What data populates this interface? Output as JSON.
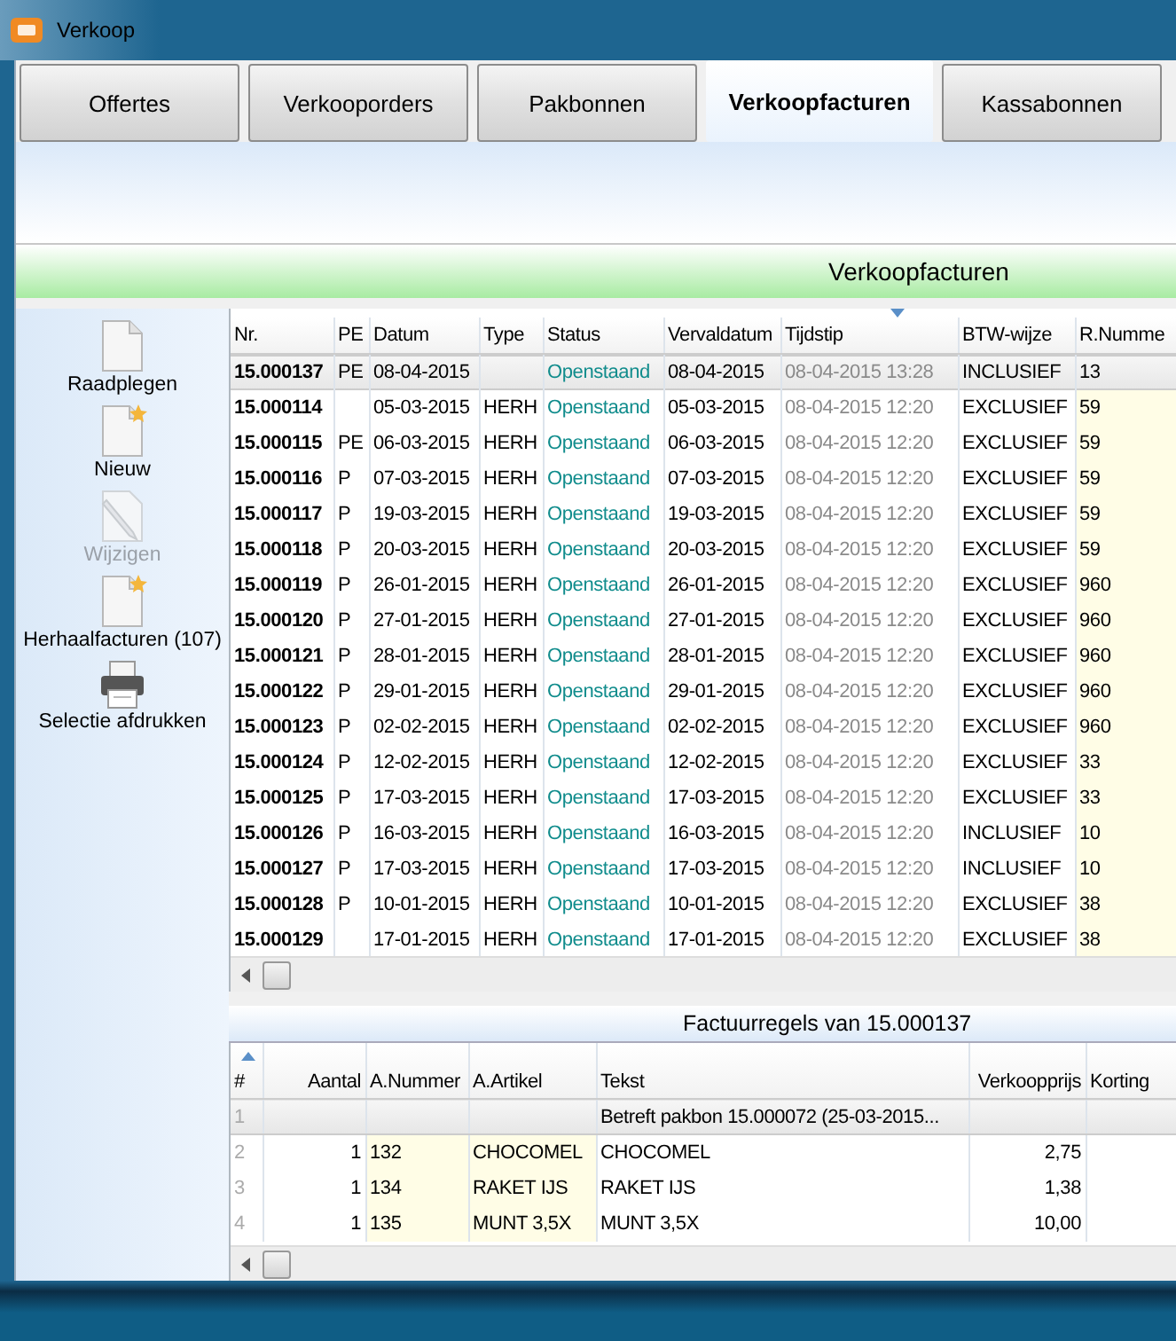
{
  "window": {
    "title": "Verkoop"
  },
  "tabs": [
    {
      "label": "Offertes",
      "selected": false
    },
    {
      "label": "Verkooporders",
      "selected": false
    },
    {
      "label": "Pakbonnen",
      "selected": false
    },
    {
      "label": "Verkoopfacturen",
      "selected": true
    },
    {
      "label": "Kassabonnen",
      "selected": false
    }
  ],
  "section_title": "Verkoopfacturen",
  "sidebar": {
    "items": [
      {
        "label": "Raadplegen",
        "kind": "document",
        "disabled": false
      },
      {
        "label": "Nieuw",
        "kind": "new-document",
        "disabled": false
      },
      {
        "label": "Wijzigen",
        "kind": "edit",
        "disabled": true
      },
      {
        "label": "Herhaalfacturen (107)",
        "kind": "new-document",
        "disabled": false
      },
      {
        "label": "Selectie afdrukken",
        "kind": "printer",
        "disabled": false
      }
    ]
  },
  "invoices": {
    "columns": [
      "Nr.",
      "PE",
      "Datum",
      "Type",
      "Status",
      "Vervaldatum",
      "Tijdstip",
      "BTW-wijze",
      "R.Numme"
    ],
    "rows": [
      {
        "selected": true,
        "cells": [
          "15.000137",
          "PE",
          "08-04-2015",
          "",
          "Openstaand",
          "08-04-2015",
          "08-04-2015 13:28",
          "INCLUSIEF",
          "13"
        ]
      },
      {
        "selected": false,
        "cells": [
          "15.000114",
          "",
          "05-03-2015",
          "HERH",
          "Openstaand",
          "05-03-2015",
          "08-04-2015 12:20",
          "EXCLUSIEF",
          "59"
        ]
      },
      {
        "selected": false,
        "cells": [
          "15.000115",
          "PE",
          "06-03-2015",
          "HERH",
          "Openstaand",
          "06-03-2015",
          "08-04-2015 12:20",
          "EXCLUSIEF",
          "59"
        ]
      },
      {
        "selected": false,
        "cells": [
          "15.000116",
          "P",
          "07-03-2015",
          "HERH",
          "Openstaand",
          "07-03-2015",
          "08-04-2015 12:20",
          "EXCLUSIEF",
          "59"
        ]
      },
      {
        "selected": false,
        "cells": [
          "15.000117",
          "P",
          "19-03-2015",
          "HERH",
          "Openstaand",
          "19-03-2015",
          "08-04-2015 12:20",
          "EXCLUSIEF",
          "59"
        ]
      },
      {
        "selected": false,
        "cells": [
          "15.000118",
          "P",
          "20-03-2015",
          "HERH",
          "Openstaand",
          "20-03-2015",
          "08-04-2015 12:20",
          "EXCLUSIEF",
          "59"
        ]
      },
      {
        "selected": false,
        "cells": [
          "15.000119",
          "P",
          "26-01-2015",
          "HERH",
          "Openstaand",
          "26-01-2015",
          "08-04-2015 12:20",
          "EXCLUSIEF",
          "960"
        ]
      },
      {
        "selected": false,
        "cells": [
          "15.000120",
          "P",
          "27-01-2015",
          "HERH",
          "Openstaand",
          "27-01-2015",
          "08-04-2015 12:20",
          "EXCLUSIEF",
          "960"
        ]
      },
      {
        "selected": false,
        "cells": [
          "15.000121",
          "P",
          "28-01-2015",
          "HERH",
          "Openstaand",
          "28-01-2015",
          "08-04-2015 12:20",
          "EXCLUSIEF",
          "960"
        ]
      },
      {
        "selected": false,
        "cells": [
          "15.000122",
          "P",
          "29-01-2015",
          "HERH",
          "Openstaand",
          "29-01-2015",
          "08-04-2015 12:20",
          "EXCLUSIEF",
          "960"
        ]
      },
      {
        "selected": false,
        "cells": [
          "15.000123",
          "P",
          "02-02-2015",
          "HERH",
          "Openstaand",
          "02-02-2015",
          "08-04-2015 12:20",
          "EXCLUSIEF",
          "960"
        ]
      },
      {
        "selected": false,
        "cells": [
          "15.000124",
          "P",
          "12-02-2015",
          "HERH",
          "Openstaand",
          "12-02-2015",
          "08-04-2015 12:20",
          "EXCLUSIEF",
          "33"
        ]
      },
      {
        "selected": false,
        "cells": [
          "15.000125",
          "P",
          "17-03-2015",
          "HERH",
          "Openstaand",
          "17-03-2015",
          "08-04-2015 12:20",
          "EXCLUSIEF",
          "33"
        ]
      },
      {
        "selected": false,
        "cells": [
          "15.000126",
          "P",
          "16-03-2015",
          "HERH",
          "Openstaand",
          "16-03-2015",
          "08-04-2015 12:20",
          "INCLUSIEF",
          "10"
        ]
      },
      {
        "selected": false,
        "cells": [
          "15.000127",
          "P",
          "17-03-2015",
          "HERH",
          "Openstaand",
          "17-03-2015",
          "08-04-2015 12:20",
          "INCLUSIEF",
          "10"
        ]
      },
      {
        "selected": false,
        "cells": [
          "15.000128",
          "P",
          "10-01-2015",
          "HERH",
          "Openstaand",
          "10-01-2015",
          "08-04-2015 12:20",
          "EXCLUSIEF",
          "38"
        ]
      },
      {
        "selected": false,
        "cells": [
          "15.000129",
          "",
          "17-01-2015",
          "HERH",
          "Openstaand",
          "17-01-2015",
          "08-04-2015 12:20",
          "EXCLUSIEF",
          "38"
        ]
      }
    ]
  },
  "lines": {
    "title": "Factuurregels van 15.000137",
    "columns": [
      "#",
      "Aantal",
      "A.Nummer",
      "A.Artikel",
      "Tekst",
      "Verkoopprijs",
      "Korting"
    ],
    "rows": [
      {
        "kind": "note",
        "cells": [
          "1",
          "",
          "",
          "",
          "Betreft pakbon 15.000072 (25-03-2015...",
          "",
          ""
        ]
      },
      {
        "kind": "item",
        "cells": [
          "2",
          "1",
          "132",
          "CHOCOMEL",
          "CHOCOMEL",
          "2,75",
          ""
        ]
      },
      {
        "kind": "item",
        "cells": [
          "3",
          "1",
          "134",
          "RAKET IJS",
          "RAKET IJS",
          "1,38",
          ""
        ]
      },
      {
        "kind": "item",
        "cells": [
          "4",
          "1",
          "135",
          "MUNT 3,5X",
          "MUNT 3,5X",
          "10,00",
          ""
        ]
      }
    ]
  }
}
